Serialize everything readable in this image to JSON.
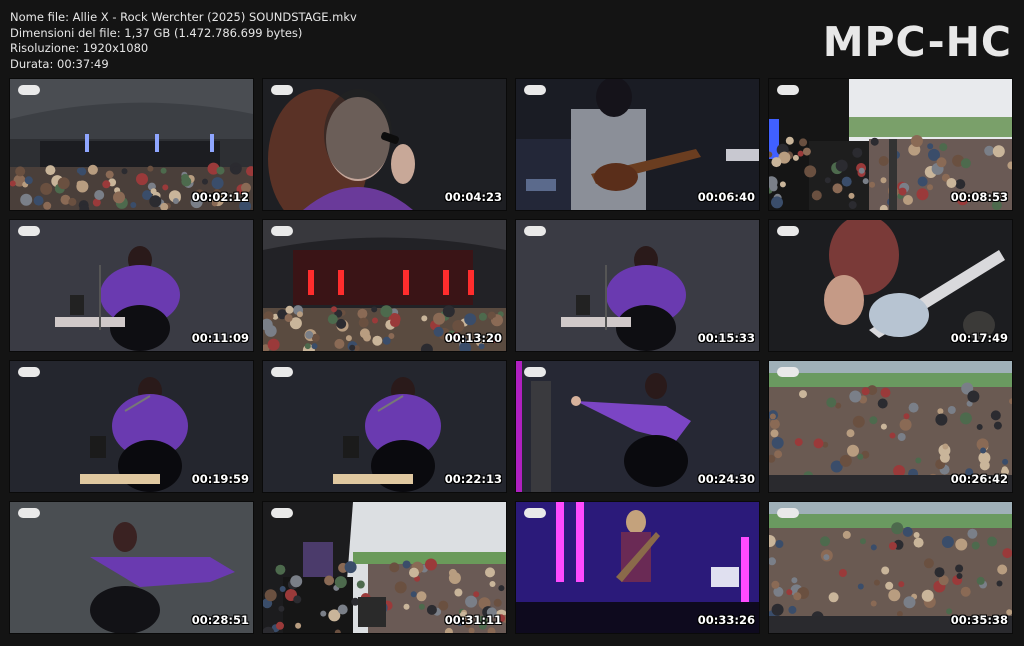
{
  "info": {
    "filename": "Nome file: Allie X - Rock Werchter (2025) SOUNDSTAGE.mkv",
    "filesize": "Dimensioni del file: 1,37 GB (1.472.786.699 bytes)",
    "resolution": "Risoluzione: 1920x1080",
    "duration": "Durata: 00:37:49"
  },
  "logo": "MPC-HC",
  "thumbnails": [
    {
      "time": "00:02:12",
      "scene": "wide-stage-crowd"
    },
    {
      "time": "00:04:23",
      "scene": "closeup-singer-veil"
    },
    {
      "time": "00:06:40",
      "scene": "guitarist"
    },
    {
      "time": "00:08:53",
      "scene": "side-stage-crowd"
    },
    {
      "time": "00:11:09",
      "scene": "singer-keyboard"
    },
    {
      "time": "00:13:20",
      "scene": "wide-stage-red"
    },
    {
      "time": "00:15:33",
      "scene": "singer-keyboard"
    },
    {
      "time": "00:17:49",
      "scene": "bass-closeup"
    },
    {
      "time": "00:19:59",
      "scene": "singer-keyboard-dark"
    },
    {
      "time": "00:22:13",
      "scene": "singer-keyboard-dark"
    },
    {
      "time": "00:24:30",
      "scene": "singer-arm-out"
    },
    {
      "time": "00:26:42",
      "scene": "crowd-closeup"
    },
    {
      "time": "00:28:51",
      "scene": "singer-arm-out-light"
    },
    {
      "time": "00:31:11",
      "scene": "side-stage-wide"
    },
    {
      "time": "00:33:26",
      "scene": "guitarist-purple"
    },
    {
      "time": "00:35:38",
      "scene": "crowd-closeup"
    }
  ]
}
